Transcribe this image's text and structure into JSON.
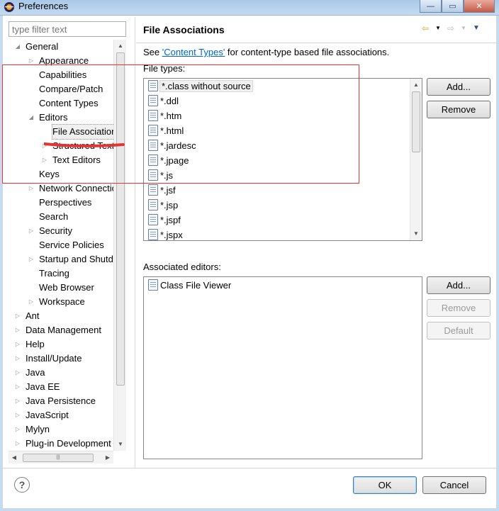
{
  "window": {
    "title": "Preferences",
    "controls": {
      "minimize": "—",
      "maximize": "▭",
      "close": "✕"
    }
  },
  "filter": {
    "placeholder": "type filter text"
  },
  "tree": [
    {
      "label": "General",
      "expanded": true
    },
    {
      "label": "Appearance",
      "expandable": true
    },
    {
      "label": "Capabilities"
    },
    {
      "label": "Compare/Patch"
    },
    {
      "label": "Content Types"
    },
    {
      "label": "Editors",
      "expanded": true
    },
    {
      "label": "File Associations",
      "selected": true
    },
    {
      "label": "Structured Text Editors",
      "expandable": true
    },
    {
      "label": "Text Editors",
      "expandable": true
    },
    {
      "label": "Keys"
    },
    {
      "label": "Network Connections",
      "expandable": true
    },
    {
      "label": "Perspectives"
    },
    {
      "label": "Search"
    },
    {
      "label": "Security",
      "expandable": true
    },
    {
      "label": "Service Policies"
    },
    {
      "label": "Startup and Shutdown",
      "expandable": true
    },
    {
      "label": "Tracing"
    },
    {
      "label": "Web Browser"
    },
    {
      "label": "Workspace",
      "expandable": true
    },
    {
      "label": "Ant",
      "expandable": true
    },
    {
      "label": "Data Management",
      "expandable": true
    },
    {
      "label": "Help",
      "expandable": true
    },
    {
      "label": "Install/Update",
      "expandable": true
    },
    {
      "label": "Java",
      "expandable": true
    },
    {
      "label": "Java EE",
      "expandable": true
    },
    {
      "label": "Java Persistence",
      "expandable": true
    },
    {
      "label": "JavaScript",
      "expandable": true
    },
    {
      "label": "Mylyn",
      "expandable": true
    },
    {
      "label": "Plug-in Development",
      "expandable": true
    }
  ],
  "page": {
    "title": "File Associations",
    "see_prefix": "See ",
    "see_link": "'Content Types'",
    "see_suffix": " for content-type based file associations.",
    "file_types_label": "File types:",
    "file_types": [
      "*.class without source",
      "*.ddl",
      "*.htm",
      "*.html",
      "*.jardesc",
      "*.jpage",
      "*.js",
      "*.jsf",
      "*.jsp",
      "*.jspf",
      "*.jspx"
    ],
    "selected_file_type": "*.class without source",
    "file_type_buttons": {
      "add": "Add...",
      "remove": "Remove"
    },
    "associated_label": "Associated editors:",
    "associated_editors": [
      "Class File Viewer"
    ],
    "editor_buttons": {
      "add": "Add...",
      "remove": "Remove",
      "default": "Default"
    }
  },
  "footer": {
    "help": "?",
    "ok": "OK",
    "cancel": "Cancel"
  },
  "nav_icons": [
    "back-arrow-icon",
    "back-menu-icon",
    "forward-arrow-icon",
    "forward-menu-icon",
    "view-menu-icon"
  ],
  "colors": {
    "link": "#0066cc",
    "annotation": "#e33333",
    "accent": "#3c7fb1"
  }
}
